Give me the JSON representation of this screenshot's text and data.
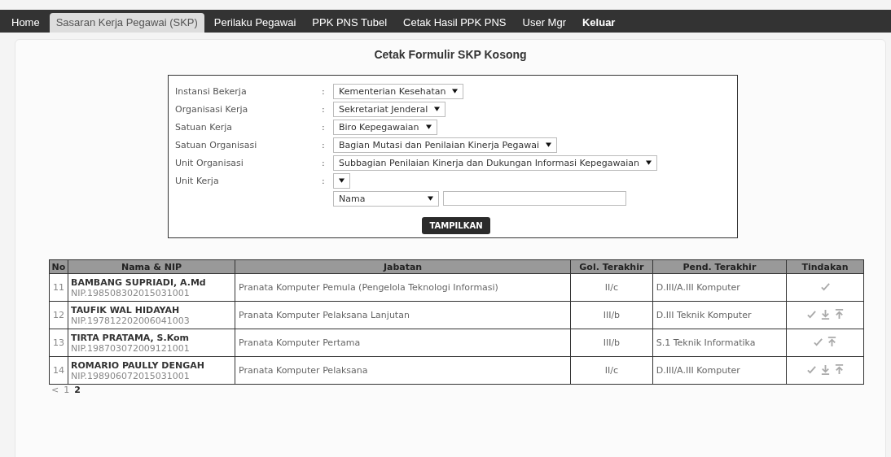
{
  "nav": [
    {
      "label": "Home",
      "selected": false,
      "bold": false
    },
    {
      "label": "Sasaran Kerja Pegawai (SKP)",
      "selected": true,
      "bold": false
    },
    {
      "label": "Perilaku Pegawai",
      "selected": false,
      "bold": false
    },
    {
      "label": "PPK PNS Tubel",
      "selected": false,
      "bold": false
    },
    {
      "label": "Cetak Hasil PPK PNS",
      "selected": false,
      "bold": false
    },
    {
      "label": "User Mgr",
      "selected": false,
      "bold": false
    },
    {
      "label": "Keluar",
      "selected": false,
      "bold": true
    }
  ],
  "title": "Cetak Formulir SKP Kosong",
  "form": {
    "fields": [
      {
        "label": "Instansi Bekerja",
        "separator": ":",
        "value": "Kementerian Kesehatan"
      },
      {
        "label": "Organisasi Kerja",
        "separator": ":",
        "value": "Sekretariat Jenderal"
      },
      {
        "label": "Satuan Kerja",
        "separator": ":",
        "value": "Biro Kepegawaian"
      },
      {
        "label": "Satuan Organisasi",
        "separator": ":",
        "value": "Bagian Mutasi dan Penilaian Kinerja Pegawai"
      },
      {
        "label": "Unit Organisasi",
        "separator": ":",
        "value": "Subbagian Penilaian Kinerja dan Dukungan Informasi Kepegawaian"
      },
      {
        "label": "Unit Kerja",
        "separator": ":"
      }
    ],
    "search_by": "Nama",
    "button": "TAMPILKAN"
  },
  "table": {
    "columns": [
      "No",
      "Nama & NIP",
      "Jabatan",
      "Gol. Terakhir",
      "Pend. Terakhir",
      "Tindakan"
    ],
    "rows": [
      {
        "no": "11",
        "name": "BAMBANG SUPRIADI, A.Md",
        "nip": "NIP.198508302015031001",
        "jabatan": "Pranata Komputer Pemula (Pengelola Teknologi Informasi)",
        "gol": "II/c",
        "pend": "D.III/A.III Komputer",
        "actions": [
          {
            "kind": "check"
          }
        ]
      },
      {
        "no": "12",
        "name": "TAUFIK WAL HIDAYAH",
        "nip": "NIP.197812202006041003",
        "jabatan": "Pranata Komputer Pelaksana Lanjutan",
        "gol": "III/b",
        "pend": "D.III Teknik Komputer",
        "actions": [
          {
            "kind": "check"
          },
          {
            "kind": "down"
          },
          {
            "kind": "up"
          }
        ]
      },
      {
        "no": "13",
        "name": "TIRTA PRATAMA, S.Kom",
        "nip": "NIP.198703072009121001",
        "jabatan": "Pranata Komputer Pertama",
        "gol": "III/b",
        "pend": "S.1 Teknik Informatika",
        "actions": [
          {
            "kind": "check"
          },
          {
            "kind": "up"
          }
        ]
      },
      {
        "no": "14",
        "name": "ROMARIO PAULLY DENGAH",
        "nip": "NIP.198906072015031001",
        "jabatan": "Pranata Komputer Pelaksana",
        "gol": "II/c",
        "pend": "D.III/A.III Komputer",
        "actions": [
          {
            "kind": "check"
          },
          {
            "kind": "down"
          },
          {
            "kind": "up"
          }
        ]
      }
    ]
  },
  "pagination": [
    {
      "label": "<",
      "selected": false
    },
    {
      "label": "1",
      "selected": false
    },
    {
      "label": "2",
      "selected": true
    }
  ]
}
